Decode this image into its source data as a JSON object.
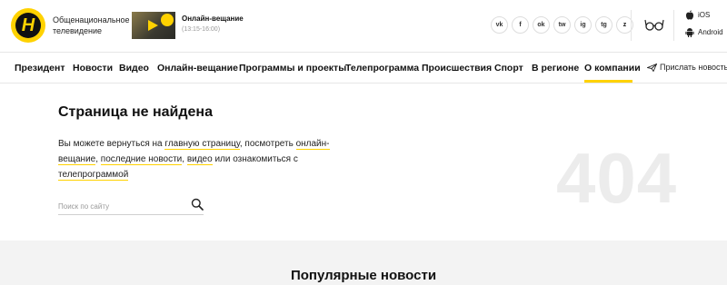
{
  "brand": {
    "logo_letter": "Н",
    "line1": "Общенациональное",
    "line2": "телевидение"
  },
  "live": {
    "title": "Онлайн-вещание",
    "time": "(13:15-16:00)"
  },
  "socials": [
    {
      "icon": "vk-icon",
      "glyph": "vk"
    },
    {
      "icon": "facebook-icon",
      "glyph": "f"
    },
    {
      "icon": "odnoklassniki-icon",
      "glyph": "ok"
    },
    {
      "icon": "twitter-icon",
      "glyph": "tw"
    },
    {
      "icon": "instagram-icon",
      "glyph": "ig"
    },
    {
      "icon": "telegram-icon",
      "glyph": "tg"
    },
    {
      "icon": "yandex-zen-icon",
      "glyph": "z"
    }
  ],
  "apps": {
    "ios": "iOS",
    "android": "Android"
  },
  "nav": {
    "items": [
      "Президент",
      "Новости",
      "Видео",
      "Онлайн-вещание",
      "Программы и проекты",
      "Телепрограмма",
      "Происшествия",
      "Спорт",
      "В регионе",
      "О компании"
    ],
    "active": "О компании",
    "send_news": "Прислать новость"
  },
  "page": {
    "title": "Страница не найдена",
    "msg_1": "Вы можете вернуться на ",
    "link_home": "главную страницу",
    "msg_2": ", посмотреть ",
    "link_live": "онлайн-вещание",
    "msg_3": ", ",
    "link_news": "последние новости",
    "msg_4": ", ",
    "link_video": "видео",
    "msg_5": " или ознакомиться с ",
    "link_tvguide": "телепрограммой",
    "big_code": "404"
  },
  "search": {
    "placeholder": "Поиск по сайту",
    "value": ""
  },
  "popular": {
    "title": "Популярные новости"
  },
  "colors": {
    "accent": "#ffd200",
    "text": "#111111",
    "muted": "#999999",
    "light_bg": "#f3f3f3"
  }
}
